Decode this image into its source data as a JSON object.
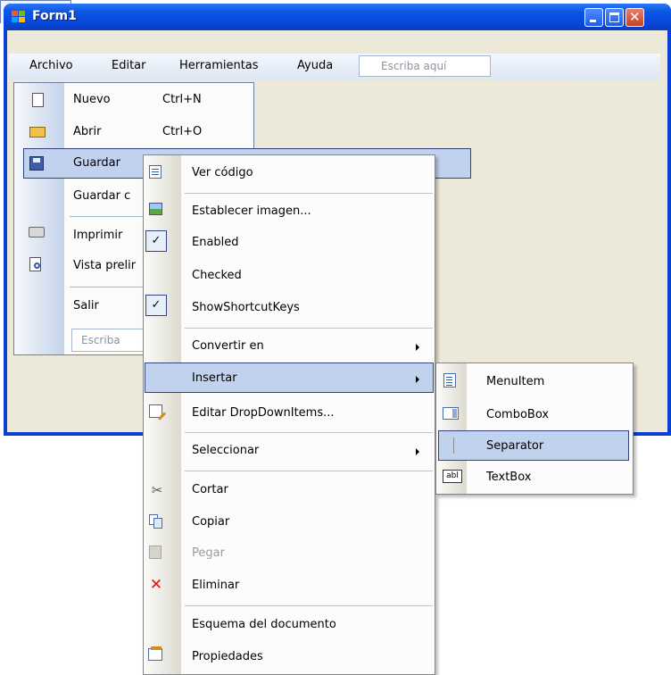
{
  "window": {
    "title": "Form1"
  },
  "menubar": {
    "items": [
      {
        "label": "Archivo"
      },
      {
        "label": "Editar"
      },
      {
        "label": "Herramientas"
      },
      {
        "label": "Ayuda"
      }
    ],
    "type_here": "Escriba aquí"
  },
  "archivo_menu": {
    "items": [
      {
        "label": "Nuevo",
        "shortcut": "Ctrl+N",
        "icon": "new-document-icon"
      },
      {
        "label": "Abrir",
        "shortcut": "Ctrl+O",
        "icon": "open-folder-icon"
      },
      {
        "label": "Guardar",
        "icon": "save-disk-icon"
      },
      {
        "label": "Guardar c"
      },
      {
        "label": "Imprimir",
        "icon": "printer-icon"
      },
      {
        "label": "Vista prelir",
        "icon": "print-preview-icon"
      },
      {
        "label": "Salir"
      }
    ],
    "type_here": "Escriba"
  },
  "context_menu": {
    "items": [
      {
        "label": "Ver código",
        "icon": "view-code-icon"
      },
      {
        "label": "Establecer imagen...",
        "icon": "image-icon"
      },
      {
        "label": "Enabled",
        "checked": true
      },
      {
        "label": "Checked",
        "checked": false
      },
      {
        "label": "ShowShortcutKeys",
        "checked": true
      },
      {
        "label": "Convertir en",
        "submenu": true
      },
      {
        "label": "Insertar",
        "submenu": true
      },
      {
        "label": "Editar DropDownItems...",
        "icon": "edit-items-icon"
      },
      {
        "label": "Seleccionar",
        "submenu": true
      },
      {
        "label": "Cortar",
        "icon": "scissors-icon"
      },
      {
        "label": "Copiar",
        "icon": "copy-icon"
      },
      {
        "label": "Pegar",
        "icon": "paste-icon",
        "disabled": true
      },
      {
        "label": "Eliminar",
        "icon": "delete-x-icon"
      },
      {
        "label": "Esquema del documento"
      },
      {
        "label": "Propiedades",
        "icon": "properties-icon"
      }
    ]
  },
  "insert_submenu": {
    "items": [
      {
        "label": "MenuItem",
        "icon": "menuitem-icon"
      },
      {
        "label": "ComboBox",
        "icon": "combobox-icon"
      },
      {
        "label": "Separator",
        "icon": "separator-icon"
      },
      {
        "label": "TextBox",
        "icon": "textbox-icon",
        "icon_text": "abl"
      }
    ]
  },
  "colors": {
    "titlebar": "#0a4fe0",
    "selection": "#c1d2ee",
    "selection_border": "#33427a",
    "client_bg": "#ece9d8"
  }
}
